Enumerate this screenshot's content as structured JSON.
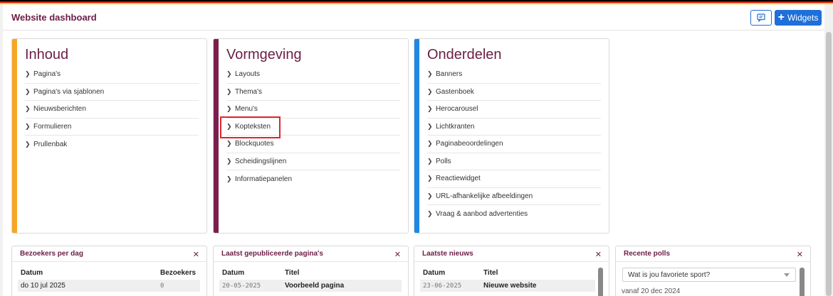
{
  "header": {
    "title": "Website dashboard",
    "feedback_icon": "comment-icon",
    "widgets_label": "Widgets"
  },
  "colors": {
    "flag": [
      "#000000",
      "#d7141a",
      "#ffce00"
    ],
    "brand": "#6b1d45",
    "primary_button": "#1e6fd9",
    "accent_inhoud": "#f5a623",
    "accent_vormgeving": "#7a1f4c",
    "accent_onderdelen": "#1e88e5",
    "highlight": "#e0252b"
  },
  "cards": [
    {
      "title": "Inhoud",
      "items": [
        "Pagina's",
        "Pagina's via sjablonen",
        "Nieuwsberichten",
        "Formulieren",
        "Prullenbak"
      ]
    },
    {
      "title": "Vormgeving",
      "items": [
        "Layouts",
        "Thema's",
        "Menu's",
        "Kopteksten",
        "Blockquotes",
        "Scheidingslijnen",
        "Informatiepanelen"
      ]
    },
    {
      "title": "Onderdelen",
      "items": [
        "Banners",
        "Gastenboek",
        "Herocarousel",
        "Lichtkranten",
        "Paginabeoordelingen",
        "Polls",
        "Reactiewidget",
        "URL-afhankelijke afbeeldingen",
        "Vraag & aanbod advertenties"
      ]
    }
  ],
  "widgets": {
    "visitors": {
      "title": "Bezoekers per dag",
      "columns": [
        "Datum",
        "Bezoekers"
      ],
      "rows": [
        [
          "do 10 jul 2025",
          "0"
        ]
      ]
    },
    "published": {
      "title": "Laatst gepubliceerde pagina's",
      "columns": [
        "Datum",
        "Titel"
      ],
      "rows": [
        [
          "20-05-2025",
          "Voorbeeld pagina"
        ]
      ]
    },
    "news": {
      "title": "Laatste nieuws",
      "columns": [
        "Datum",
        "Titel"
      ],
      "rows": [
        [
          "23-06-2025",
          "Nieuwe website"
        ]
      ]
    },
    "polls": {
      "title": "Recente polls",
      "select_value": "Wat is jou favoriete sport?",
      "since": "vanaf 20 dec 2024"
    }
  }
}
